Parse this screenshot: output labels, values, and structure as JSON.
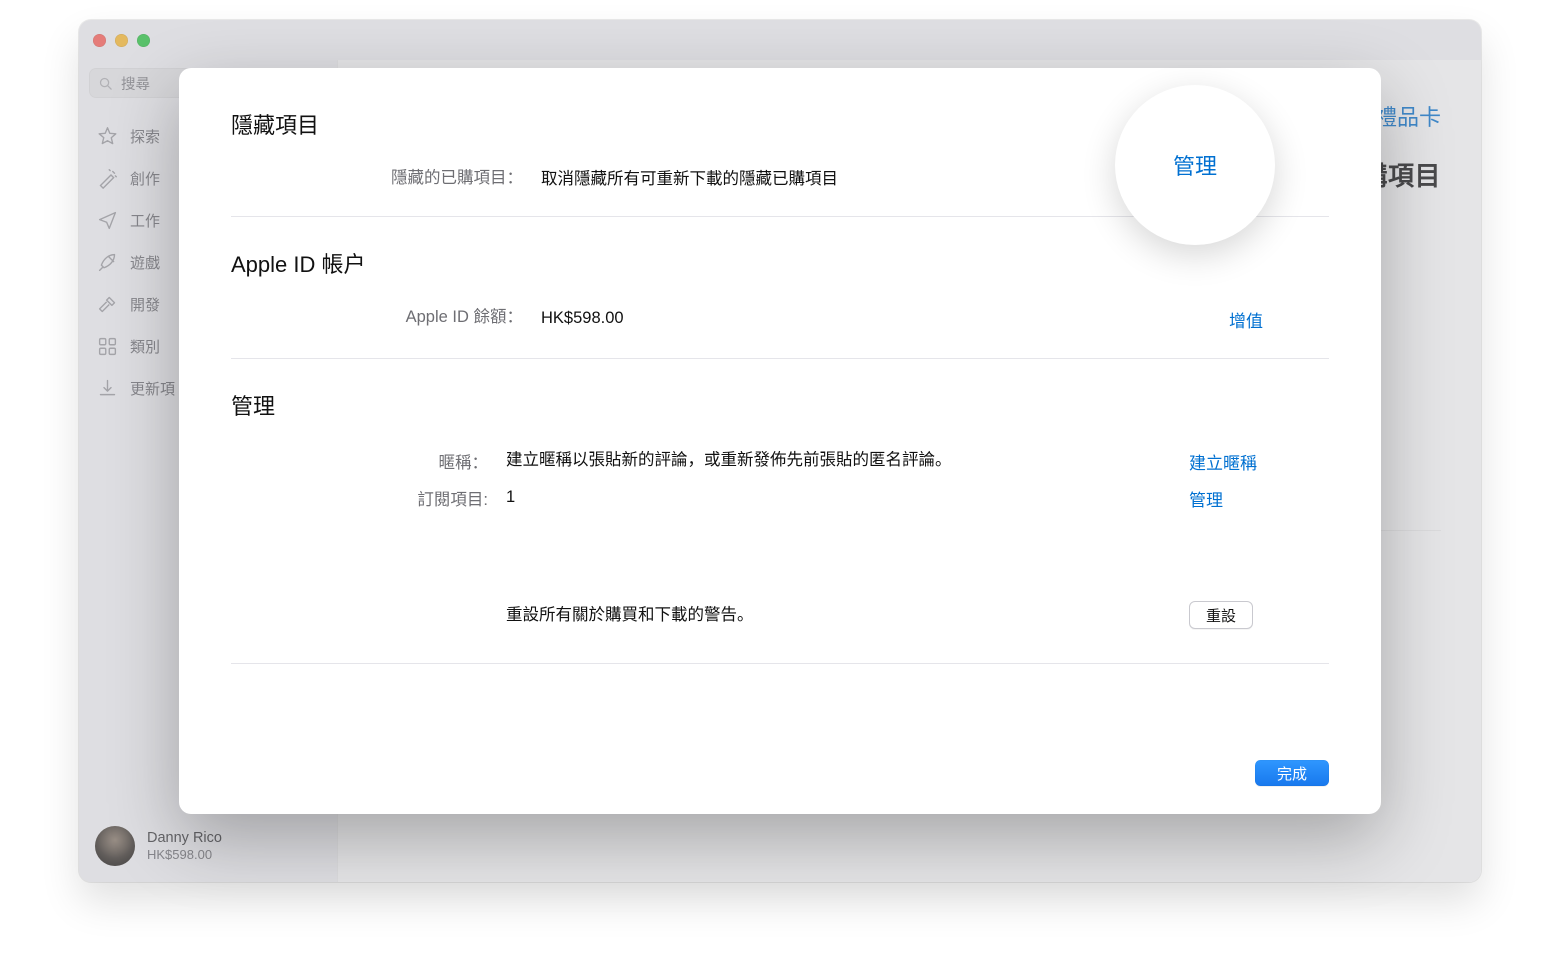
{
  "colors": {
    "link": "#0070d1"
  },
  "window": {
    "search_placeholder": "搜尋",
    "sidebar": {
      "items": [
        {
          "label": "探索",
          "icon": "star-icon"
        },
        {
          "label": "創作",
          "icon": "wand-icon"
        },
        {
          "label": "工作",
          "icon": "paperplane-icon"
        },
        {
          "label": "遊戲",
          "icon": "rocket-icon"
        },
        {
          "label": "開發",
          "icon": "hammer-icon"
        },
        {
          "label": "類別",
          "icon": "grid-icon"
        },
        {
          "label": "更新項",
          "icon": "download-icon"
        }
      ]
    },
    "profile": {
      "name": "Danny Rico",
      "balance": "HK$598.00"
    },
    "main": {
      "topright_link": "禮品卡",
      "heading_fragment": "購項目"
    }
  },
  "modal": {
    "sections": {
      "hidden": {
        "title": "隱藏項目",
        "row_label": "隱藏的已購項目：",
        "row_value": "取消隱藏所有可重新下載的隱藏已購項目",
        "action": "管理"
      },
      "account": {
        "title": "Apple ID 帳户",
        "row_label": "Apple ID 餘額：",
        "row_value": "HK$598.00",
        "action": "增值"
      },
      "manage": {
        "title": "管理",
        "rows": [
          {
            "label": "暱稱：",
            "value": "建立暱稱以張貼新的評論，或重新發佈先前張貼的匿名評論。",
            "action": "建立暱稱"
          },
          {
            "label": "訂閱項目:",
            "value": "1",
            "action": "管理"
          }
        ],
        "reset_text": "重設所有關於購買和下載的警告。",
        "reset_button": "重設"
      }
    },
    "done_button": "完成"
  }
}
